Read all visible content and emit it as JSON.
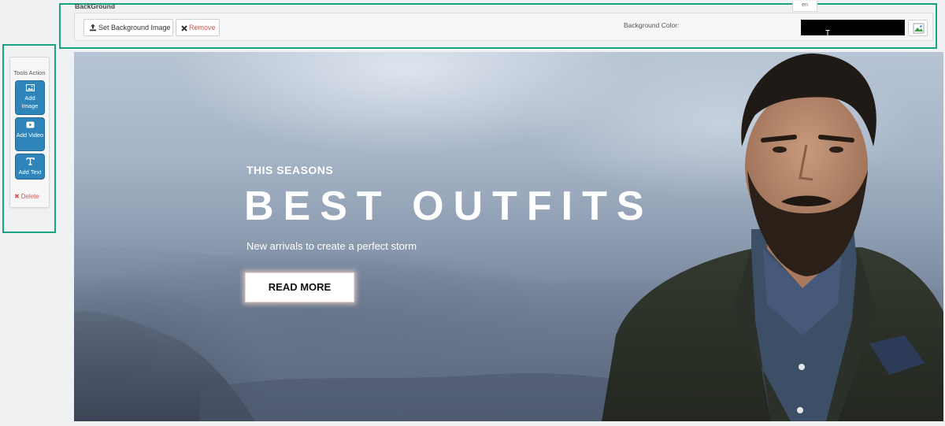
{
  "tools_panel": {
    "title": "Tools Action",
    "add_image_label": "Add Image",
    "add_video_label": "Add Video",
    "add_text_label": "Add Text",
    "delete_label": "Delete"
  },
  "background_toolbar": {
    "heading": "BackGround",
    "language_selector": "en",
    "set_background_image_label": "Set Background Image",
    "remove_label": "Remove",
    "background_color_label": "Background Color:",
    "background_color_value": "#000000"
  },
  "hero": {
    "subheading": "THIS SEASONS",
    "title": "BEST OUTFITS",
    "text": "New arrivals to create a perfect storm",
    "cta_label": "READ MORE"
  },
  "colors": {
    "accent_highlight": "#1aa383",
    "tool_button": "#2f84b9",
    "danger": "#d9534f"
  }
}
